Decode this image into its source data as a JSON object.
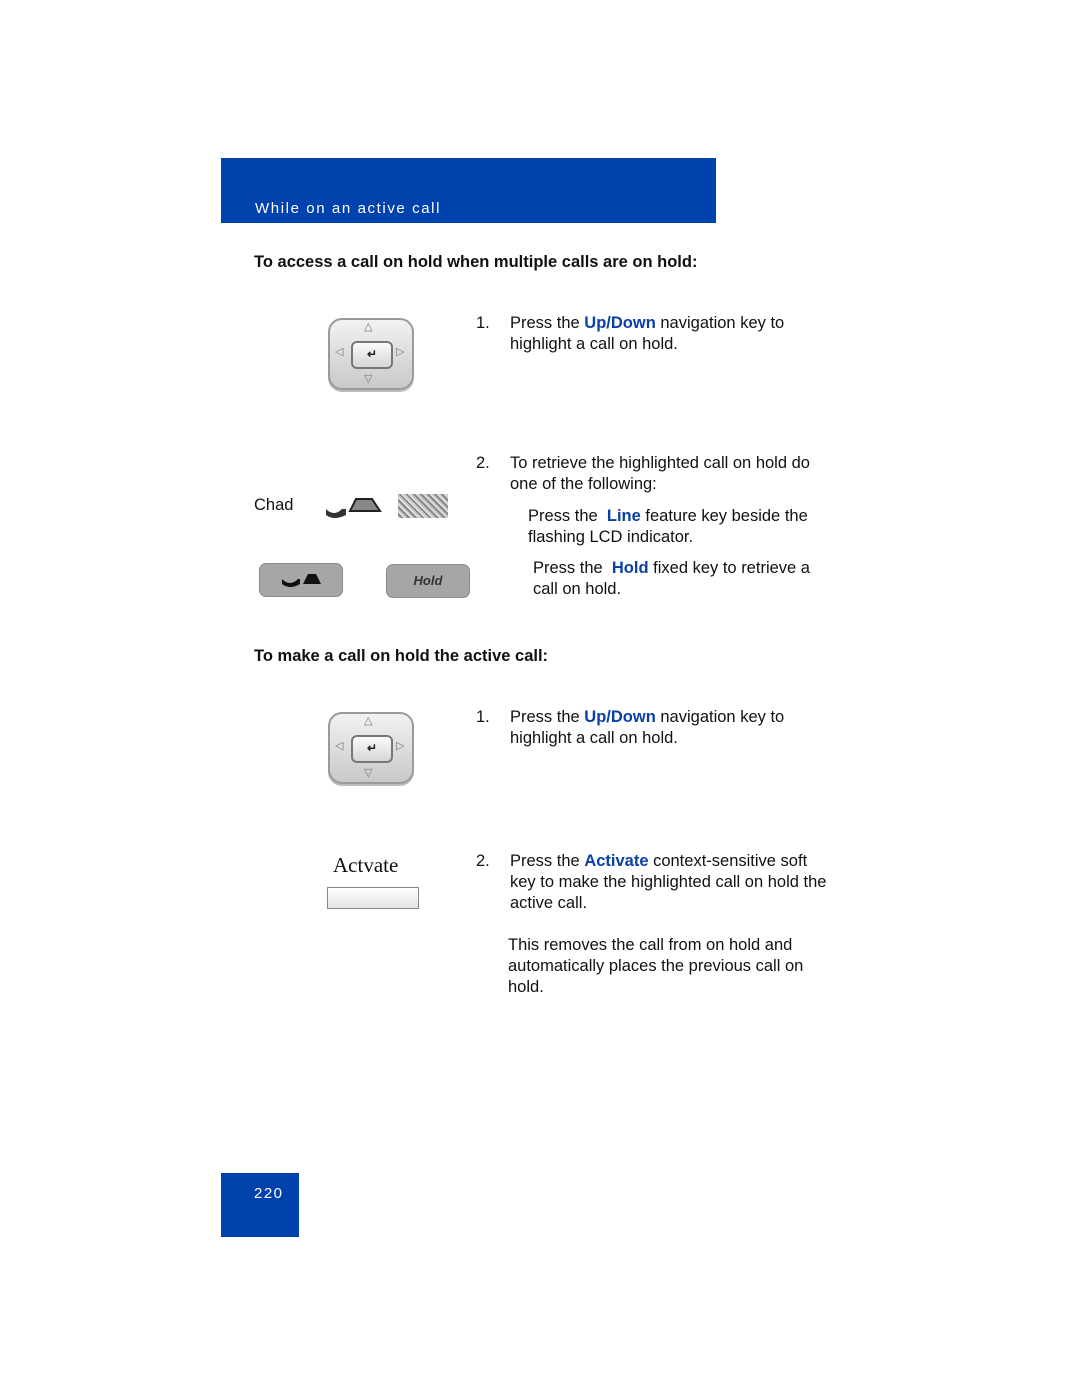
{
  "header": {
    "title": "While on an active call"
  },
  "section1": {
    "heading": "To access a call on hold when multiple calls are on hold:",
    "steps": [
      {
        "num": "1.",
        "pre": "Press the ",
        "key": "Up/Down",
        "post": " navigation key to highlight a call on hold."
      },
      {
        "num": "2.",
        "text": "To retrieve the highlighted call on hold do one of the following:"
      }
    ],
    "options": [
      {
        "pre": "Press the ",
        "key": "Line",
        "post": " feature key beside the flashing LCD indicator."
      },
      {
        "pre": "Press the ",
        "key": "Hold",
        "post": " fixed key to retrieve a call on hold."
      }
    ],
    "lcd_label": "Chad",
    "hold_key_label": "Hold"
  },
  "section2": {
    "heading": "To make a call on hold the active call:",
    "steps": [
      {
        "num": "1.",
        "pre": "Press the ",
        "key": "Up/Down",
        "post": " navigation key to highlight a call on hold."
      },
      {
        "num": "2.",
        "pre": "Press the ",
        "key": "Activate",
        "post": " context-sensitive soft key to make the highlighted call on hold the active call."
      }
    ],
    "note": "This removes the call from on hold and automatically places the previous call on hold.",
    "softkey_label": "Actvate"
  },
  "footer": {
    "page_number": "220"
  },
  "colors": {
    "brand_blue": "#0042ad",
    "key_text_blue": "#0a3fa8"
  }
}
